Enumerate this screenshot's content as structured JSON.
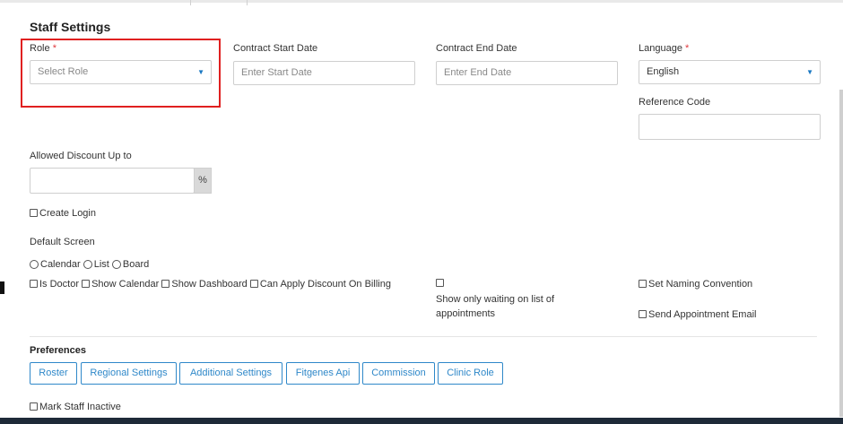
{
  "title": "Staff Settings",
  "role": {
    "label": "Role",
    "required_mark": "*",
    "placeholder": "Select Role"
  },
  "contract_start": {
    "label": "Contract Start Date",
    "placeholder": "Enter Start Date"
  },
  "contract_end": {
    "label": "Contract End Date",
    "placeholder": "Enter End Date"
  },
  "language": {
    "label": "Language",
    "required_mark": "*",
    "value": "English"
  },
  "reference_code": {
    "label": "Reference Code",
    "value": ""
  },
  "discount": {
    "label": "Allowed Discount Up to",
    "value": "",
    "addon": "%"
  },
  "create_login": {
    "label": "Create Login",
    "checked": false
  },
  "default_screen": {
    "label": "Default Screen",
    "options": [
      "Calendar",
      "List",
      "Board"
    ]
  },
  "checks": {
    "is_doctor": "Is Doctor",
    "show_calendar": "Show Calendar",
    "show_dashboard": "Show Dashboard",
    "can_apply_discount": "Can Apply Discount On Billing",
    "show_only_waiting_1": "Show only waiting on list of",
    "show_only_waiting_2": "appointments",
    "set_naming_convention": "Set Naming Convention",
    "send_appointment_email": "Send Appointment Email"
  },
  "preferences": {
    "label": "Preferences",
    "buttons": [
      "Roster",
      "Regional Settings",
      "Additional Settings",
      "Fitgenes Api",
      "Commission",
      "Clinic Role"
    ]
  },
  "mark_inactive": {
    "label": "Mark Staff Inactive",
    "checked": false
  },
  "colors": {
    "accent": "#2f88c9",
    "required": "#e0393e",
    "highlight": "#e02020"
  }
}
